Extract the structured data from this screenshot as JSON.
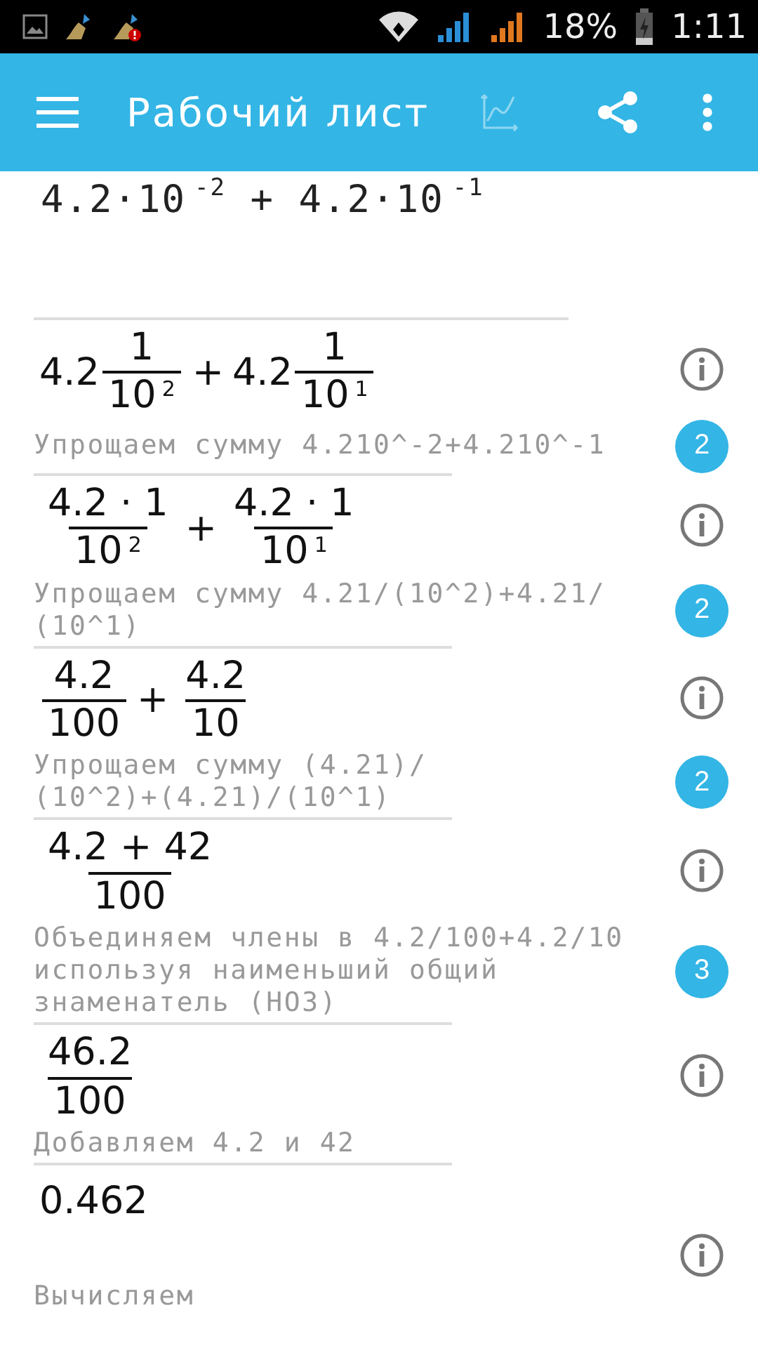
{
  "status_bar": {
    "battery": "18%",
    "time": "1:11"
  },
  "app_bar": {
    "title": "Рабочий лист",
    "actions": [
      {
        "kind": "chart",
        "disabled": true
      },
      {
        "kind": "share",
        "disabled": false
      },
      {
        "kind": "more",
        "disabled": false
      }
    ]
  },
  "input": {
    "value": "4.2·10$^{-2}$ + 4.2·10$^{-1}$"
  },
  "steps": [
    {
      "expression": [
        {
          "kind": "text",
          "text": "4.2"
        },
        {
          "kind": "frac",
          "num": [
            {
              "kind": "text",
              "text": "1"
            }
          ],
          "den": [
            {
              "kind": "text",
              "text": "10"
            },
            {
              "kind": "sup",
              "text": "2"
            }
          ]
        },
        {
          "kind": "op",
          "text": "+"
        },
        {
          "kind": "text",
          "text": "4.2"
        },
        {
          "kind": "frac",
          "num": [
            {
              "kind": "text",
              "text": "1"
            }
          ],
          "den": [
            {
              "kind": "text",
              "text": "10"
            },
            {
              "kind": "sup",
              "text": "1"
            }
          ]
        }
      ],
      "explanation": "Упрощаем сумму 4.210^-2+4.210^-1",
      "badge": "2"
    },
    {
      "expression": [
        {
          "kind": "frac",
          "num": [
            {
              "kind": "text",
              "text": "4.2 · 1"
            }
          ],
          "den": [
            {
              "kind": "text",
              "text": "10"
            },
            {
              "kind": "sup",
              "text": "2"
            }
          ]
        },
        {
          "kind": "op",
          "text": "+"
        },
        {
          "kind": "frac",
          "num": [
            {
              "kind": "text",
              "text": "4.2 · 1"
            }
          ],
          "den": [
            {
              "kind": "text",
              "text": "10"
            },
            {
              "kind": "sup",
              "text": "1"
            }
          ]
        }
      ],
      "explanation": "Упрощаем сумму 4.21/(10^2)+4.21/\n(10^1)",
      "badge": "2"
    },
    {
      "expression": [
        {
          "kind": "frac",
          "num": [
            {
              "kind": "text",
              "text": "4.2"
            }
          ],
          "den": [
            {
              "kind": "text",
              "text": "100"
            }
          ]
        },
        {
          "kind": "op",
          "text": "+"
        },
        {
          "kind": "frac",
          "num": [
            {
              "kind": "text",
              "text": "4.2"
            }
          ],
          "den": [
            {
              "kind": "text",
              "text": "10"
            }
          ]
        }
      ],
      "explanation": "Упрощаем сумму (4.21)/\n(10^2)+(4.21)/(10^1)",
      "badge": "2"
    },
    {
      "expression": [
        {
          "kind": "frac",
          "num": [
            {
              "kind": "text",
              "text": "4.2 + 42"
            }
          ],
          "den": [
            {
              "kind": "text",
              "text": "100"
            }
          ]
        }
      ],
      "explanation": "Объединяем члены в 4.2/100+4.2/10\nиспользуя наименьший общий\nзнаменатель (НОЗ)",
      "badge": "3"
    },
    {
      "expression": [
        {
          "kind": "frac",
          "num": [
            {
              "kind": "text",
              "text": "46.2"
            }
          ],
          "den": [
            {
              "kind": "text",
              "text": "100"
            }
          ]
        }
      ],
      "explanation": "Добавляем 4.2 и 42"
    },
    {
      "expression": [
        {
          "kind": "text",
          "text": "0.462"
        }
      ],
      "explanation": "Вычисляем"
    }
  ]
}
